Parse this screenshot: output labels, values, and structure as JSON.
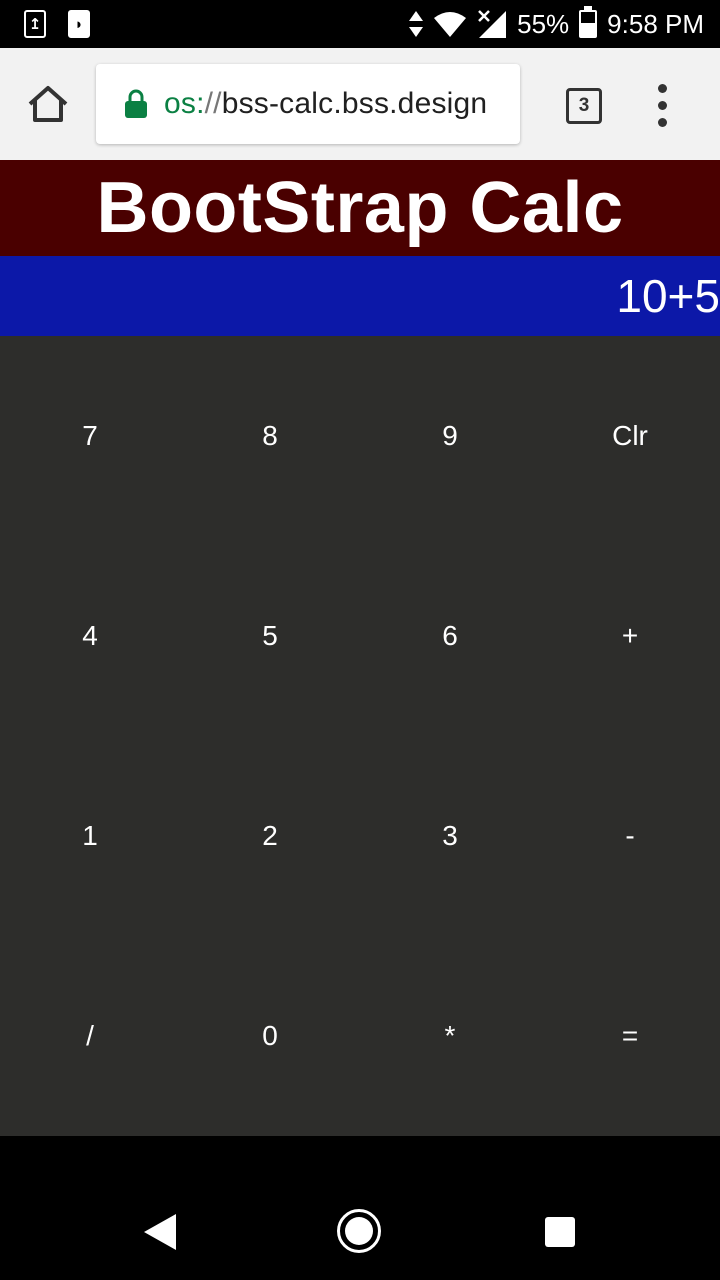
{
  "status_bar": {
    "left_icons": [
      "sync-notification-icon",
      "notification-icon"
    ],
    "battery_percent": "55%",
    "time": "9:58 PM",
    "icons": [
      "data-arrows-icon",
      "wifi-icon",
      "signal-icon",
      "battery-icon"
    ]
  },
  "browser": {
    "url_scheme": "os:",
    "url_separator": "//",
    "url_host": "bss-calc.bss.design",
    "tab_count": "3",
    "icons": [
      "home-icon",
      "lock-icon",
      "tabs-icon",
      "overflow-menu-icon"
    ]
  },
  "app": {
    "title": "BootStrap Calc",
    "display": "10+5",
    "colors": {
      "title_bg": "#4a0000",
      "display_bg": "#0c18a8",
      "keypad_bg": "#2d2d2b"
    },
    "keys": [
      [
        "7",
        "8",
        "9",
        "Clr"
      ],
      [
        "4",
        "5",
        "6",
        "+"
      ],
      [
        "1",
        "2",
        "3",
        "-"
      ],
      [
        "/",
        "0",
        "*",
        "="
      ]
    ]
  },
  "nav_bar": {
    "icons": [
      "back-icon",
      "home-circle-icon",
      "recents-icon"
    ]
  }
}
